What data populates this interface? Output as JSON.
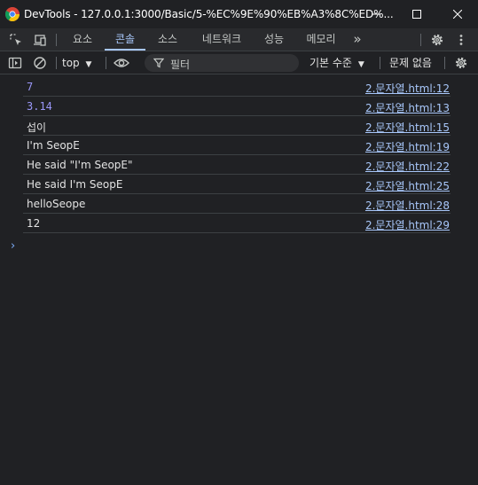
{
  "window": {
    "title": "DevTools - 127.0.0.1:3000/Basic/5-%EC%9E%90%EB%A3%8C%ED%...",
    "controls": [
      "minimize-icon",
      "maximize-icon",
      "close-icon"
    ]
  },
  "tabbar": {
    "tabs": [
      {
        "label": "요소",
        "active": false
      },
      {
        "label": "콘솔",
        "active": true
      },
      {
        "label": "소스",
        "active": false
      },
      {
        "label": "네트워크",
        "active": false
      },
      {
        "label": "성능",
        "active": false
      },
      {
        "label": "메모리",
        "active": false
      }
    ],
    "more_label": "»",
    "icons": [
      "inspect-element-icon",
      "device-toolbar-icon",
      "more-tabs-icon",
      "settings-icon",
      "kebab-menu-icon"
    ]
  },
  "console_toolbar": {
    "context": "top",
    "filter_placeholder": "필터",
    "levels_label": "기본 수준",
    "issues_label": "문제 없음",
    "icons": [
      "sidebar-toggle-icon",
      "clear-console-icon",
      "eye-icon",
      "filter-icon",
      "console-settings-icon"
    ]
  },
  "logs": [
    {
      "message": "7",
      "type": "number",
      "source": "2.문자열.html:12"
    },
    {
      "message": "3.14",
      "type": "number",
      "source": "2.문자열.html:13"
    },
    {
      "message": "섭이",
      "type": "string",
      "source": "2.문자열.html:15"
    },
    {
      "message": "I'm SeopE",
      "type": "string",
      "source": "2.문자열.html:19"
    },
    {
      "message": "He said \"I'm SeopE\"",
      "type": "string",
      "source": "2.문자열.html:22"
    },
    {
      "message": "He said I'm SeopE",
      "type": "string",
      "source": "2.문자열.html:25"
    },
    {
      "message": "helloSeope",
      "type": "string",
      "source": "2.문자열.html:28"
    },
    {
      "message": "12",
      "type": "string",
      "source": "2.문자열.html:29"
    }
  ],
  "prompt_symbol": "›",
  "colors": {
    "background": "#202124",
    "toolbar": "#292a2d",
    "accent": "#a8c7fa",
    "number": "#9a97f8",
    "divider": "#3c4043"
  }
}
